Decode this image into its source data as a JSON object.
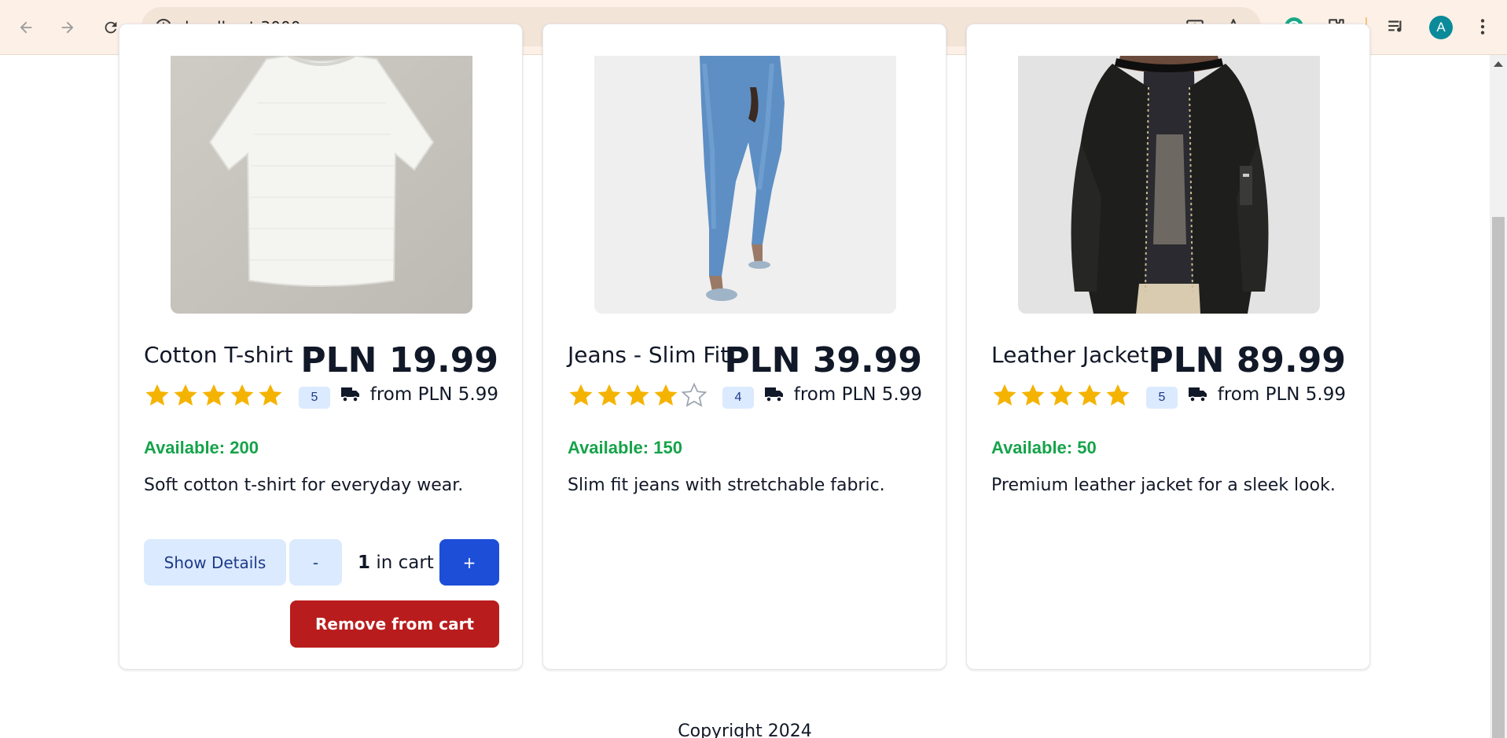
{
  "browser": {
    "url": "localhost:3000",
    "avatar_letter": "A",
    "icons": [
      "back-arrow-icon",
      "forward-arrow-icon",
      "reload-icon",
      "site-info-icon",
      "install-app-icon",
      "bookmark-star-icon",
      "grammarly-icon",
      "extensions-puzzle-icon",
      "media-controls-icon",
      "more-vert-icon"
    ]
  },
  "colors": {
    "accent_blue": "#1d4ed8",
    "light_blue": "#dbeafe",
    "danger_red": "#b91c1c",
    "available_green": "#16a34a",
    "star_gold": "#f5b301"
  },
  "products": [
    {
      "name": "Cotton T-shirt",
      "price": "PLN 19.99",
      "rating": 5,
      "rating_label": "5",
      "shipping": "from PLN 5.99",
      "available": "Available: 200",
      "description": "Soft cotton t-shirt for everyday wear.",
      "image": "white-tshirt-image",
      "in_cart": true,
      "cart_count": "1",
      "cart_suffix": " in cart",
      "show_details_label": "Show Details",
      "minus_label": "-",
      "plus_label": "+",
      "remove_label": "Remove from cart"
    },
    {
      "name": "Jeans - Slim Fit",
      "price": "PLN 39.99",
      "rating": 4,
      "rating_label": "4",
      "shipping": "from PLN 5.99",
      "available": "Available: 150",
      "description": "Slim fit jeans with stretchable fabric.",
      "image": "blue-jeans-image",
      "in_cart": false
    },
    {
      "name": "Leather Jacket",
      "price": "PLN 89.99",
      "rating": 5,
      "rating_label": "5",
      "shipping": "from PLN 5.99",
      "available": "Available: 50",
      "description": "Premium leather jacket for a sleek look.",
      "image": "leather-jacket-image",
      "in_cart": false
    }
  ],
  "footer": {
    "copyright": "Copyright 2024"
  }
}
